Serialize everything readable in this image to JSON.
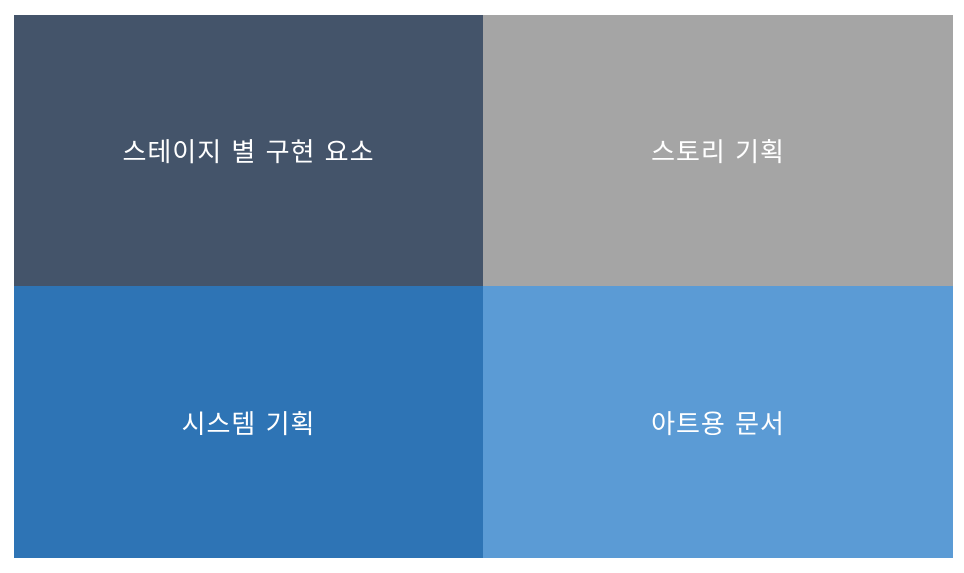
{
  "tiles": [
    {
      "label": "스테이지 별 구현 요소",
      "color": "#44546a"
    },
    {
      "label": "스토리 기획",
      "color": "#a5a5a5"
    },
    {
      "label": "시스템 기획",
      "color": "#2e74b5"
    },
    {
      "label": "아트용 문서",
      "color": "#5b9bd5"
    }
  ]
}
